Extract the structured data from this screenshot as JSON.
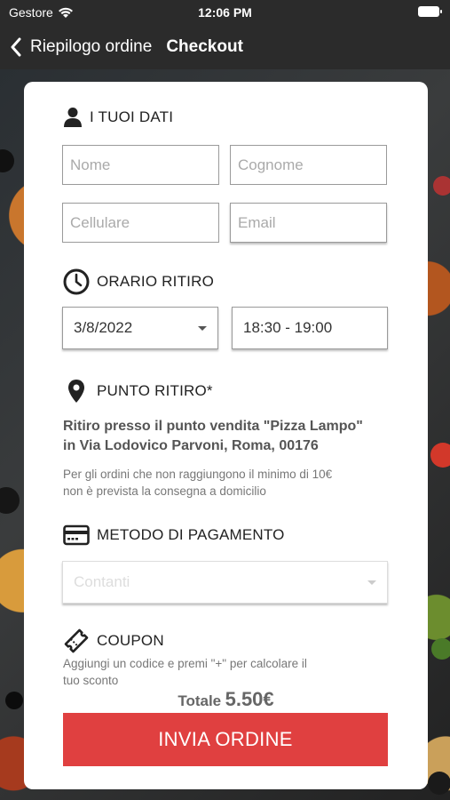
{
  "status_bar": {
    "carrier": "Gestore",
    "time": "12:06 PM"
  },
  "nav": {
    "back_label": "Riepilogo ordine",
    "title": "Checkout"
  },
  "personal": {
    "title": "I TUOI DATI",
    "name_placeholder": "Nome",
    "surname_placeholder": "Cognome",
    "phone_placeholder": "Cellulare",
    "email_placeholder": "Email"
  },
  "pickup_time": {
    "title": "ORARIO RITIRO",
    "date": "3/8/2022",
    "slot": "18:30 - 19:00"
  },
  "pickup_point": {
    "title": "PUNTO RITIRO*",
    "address_line1": "Ritiro presso il punto vendita \"Pizza Lampo\"",
    "address_line2": "in Via Lodovico Parvoni, Roma, 00176",
    "note_line1": "Per gli ordini che non raggiungono il minimo di 10€",
    "note_line2": "non è prevista la consegna a domicilio"
  },
  "payment": {
    "title": "METODO DI PAGAMENTO",
    "selected": "Contanti"
  },
  "coupon": {
    "title": "COUPON",
    "hint_line1": "Aggiungi un codice e premi \"+\" per calcolare il",
    "hint_line2": "tuo sconto"
  },
  "total": {
    "label": "Totale",
    "value": "5.50€"
  },
  "submit_label": "INVIA ORDINE",
  "colors": {
    "accent": "#e04040",
    "bar": "#2b2b2b"
  }
}
